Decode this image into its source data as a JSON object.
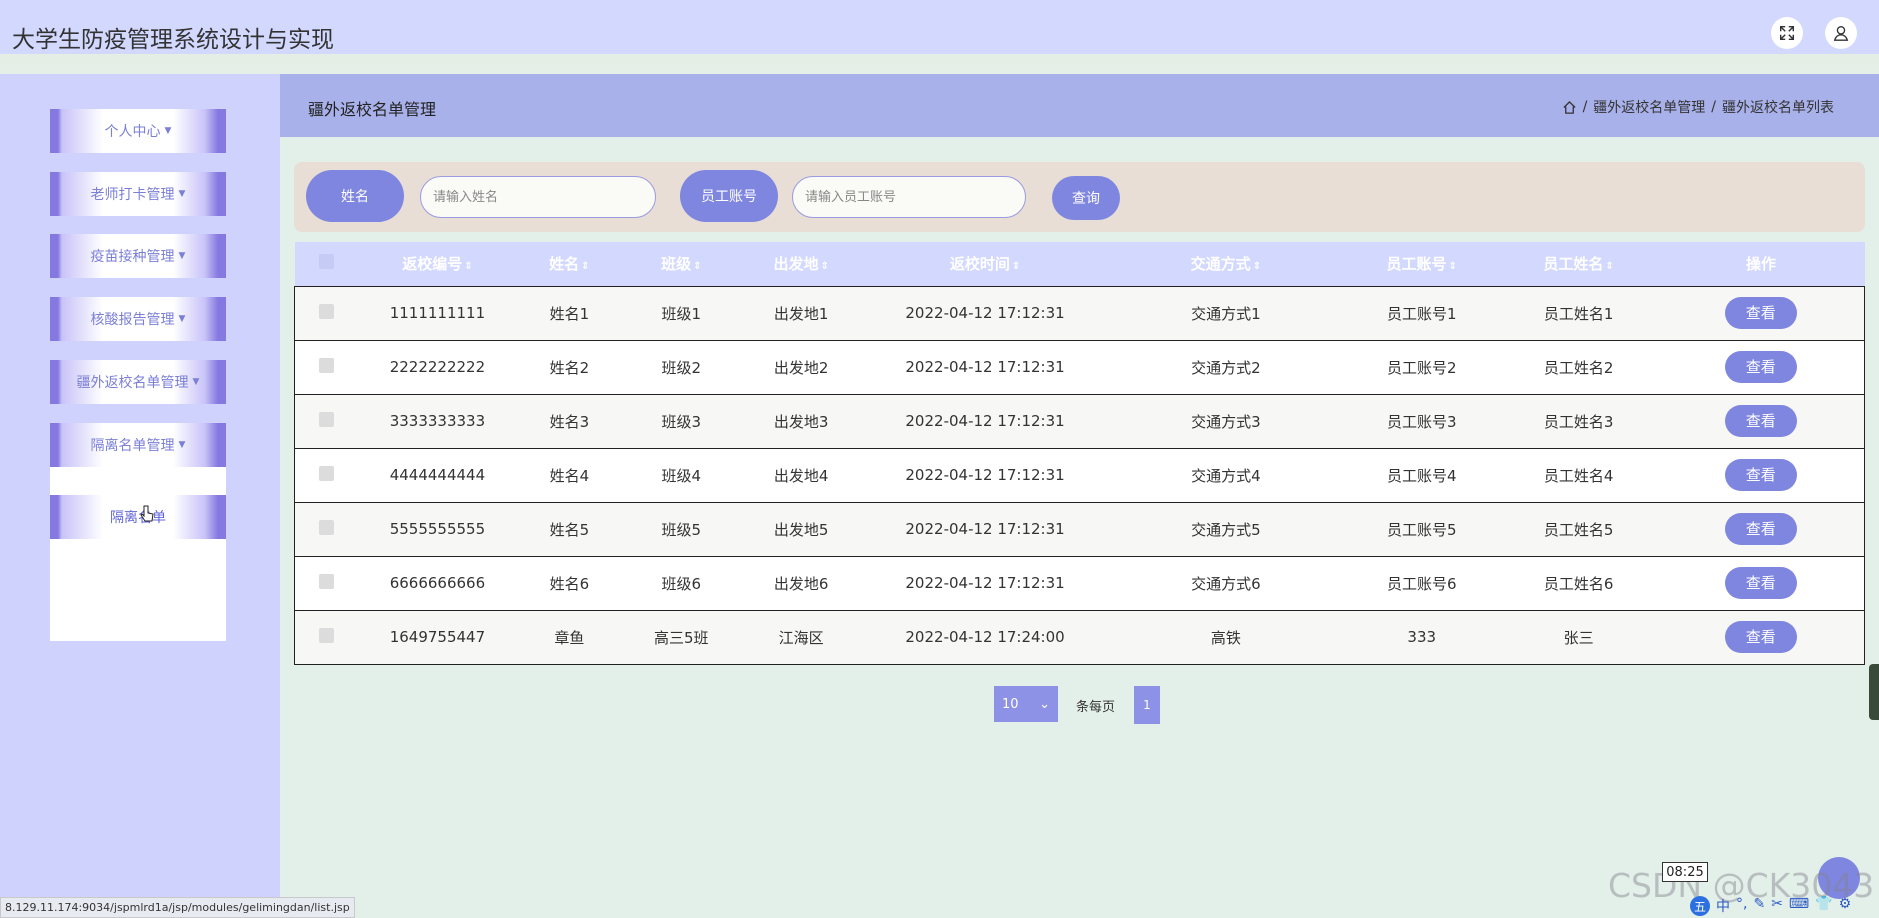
{
  "app": {
    "title": "大学生防疫管理系统设计与实现"
  },
  "sidebar": {
    "items": [
      {
        "label": "个人中心",
        "has_caret": true
      },
      {
        "label": "老师打卡管理",
        "has_caret": true
      },
      {
        "label": "疫苗接种管理",
        "has_caret": true
      },
      {
        "label": "核酸报告管理",
        "has_caret": true
      },
      {
        "label": "疆外返校名单管理",
        "has_caret": true
      },
      {
        "label": "隔离名单管理",
        "has_caret": true
      }
    ],
    "sub_item": {
      "label": "隔离名单"
    }
  },
  "page": {
    "title": "疆外返校名单管理",
    "breadcrumb": [
      "疆外返校名单管理",
      "疆外返校名单列表"
    ],
    "breadcrumb_sep": "/"
  },
  "search": {
    "name_label": "姓名",
    "name_placeholder": "请输入姓名",
    "account_label": "员工账号",
    "account_placeholder": "请输入员工账号",
    "query_label": "查询"
  },
  "table": {
    "columns": [
      "返校编号",
      "姓名",
      "班级",
      "出发地",
      "返校时间",
      "交通方式",
      "员工账号",
      "员工姓名",
      "操作"
    ],
    "sort_icon": "⇕",
    "rows": [
      [
        "1111111111",
        "姓名1",
        "班级1",
        "出发地1",
        "2022-04-12 17:12:31",
        "交通方式1",
        "员工账号1",
        "员工姓名1",
        "查看"
      ],
      [
        "2222222222",
        "姓名2",
        "班级2",
        "出发地2",
        "2022-04-12 17:12:31",
        "交通方式2",
        "员工账号2",
        "员工姓名2",
        "查看"
      ],
      [
        "3333333333",
        "姓名3",
        "班级3",
        "出发地3",
        "2022-04-12 17:12:31",
        "交通方式3",
        "员工账号3",
        "员工姓名3",
        "查看"
      ],
      [
        "4444444444",
        "姓名4",
        "班级4",
        "出发地4",
        "2022-04-12 17:12:31",
        "交通方式4",
        "员工账号4",
        "员工姓名4",
        "查看"
      ],
      [
        "5555555555",
        "姓名5",
        "班级5",
        "出发地5",
        "2022-04-12 17:12:31",
        "交通方式5",
        "员工账号5",
        "员工姓名5",
        "查看"
      ],
      [
        "6666666666",
        "姓名6",
        "班级6",
        "出发地6",
        "2022-04-12 17:12:31",
        "交通方式6",
        "员工账号6",
        "员工姓名6",
        "查看"
      ],
      [
        "1649755447",
        "章鱼",
        "高三5班",
        "江海区",
        "2022-04-12 17:24:00",
        "高铁",
        "333",
        "张三",
        "查看"
      ]
    ]
  },
  "pager": {
    "page_size": "10",
    "per_page_label": "条每页",
    "current_page": "1"
  },
  "status_url": "8.129.11.174:9034/jspmlrd1a/jsp/modules/gelimingdan/list.jsp",
  "overlay": {
    "clock": "08:25",
    "watermark": "CSDN @CK3043",
    "tray": [
      "五",
      "中",
      "°,",
      "✎",
      "✂",
      "⌨",
      "👕",
      "⚙"
    ]
  },
  "colors": {
    "accent": "#7f86e0",
    "header_bg": "#d3d8ff",
    "sidebar_bg": "#ced2fd",
    "page_header_bg": "#a8b1ea"
  },
  "icons": {
    "fullscreen": "expand-icon",
    "user": "user-icon",
    "home": "home-icon"
  }
}
